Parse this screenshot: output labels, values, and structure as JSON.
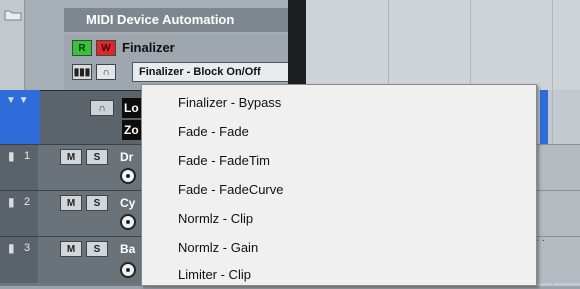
{
  "folder_track": {
    "title": "MIDI Device Automation"
  },
  "automation_track": {
    "read_label": "R",
    "write_label": "W",
    "name": "Finalizer",
    "parameter": "Finalizer - Block On/Off"
  },
  "marker_track": {
    "label_1": "Lo",
    "label_2": "Zo"
  },
  "tracks": [
    {
      "number": "1",
      "mute": "M",
      "solo": "S",
      "name": "Dr"
    },
    {
      "number": "2",
      "mute": "M",
      "solo": "S",
      "name": "Cy"
    },
    {
      "number": "3",
      "mute": "M",
      "solo": "S",
      "name": "Ba"
    }
  ],
  "popup_menu": {
    "items": [
      "Finalizer - Bypass",
      "Fade - Fade",
      "Fade - FadeTim",
      "Fade - FadeCurve",
      "Normlz - Clip",
      "Normlz - Gain",
      "Limiter - Clip"
    ]
  },
  "icons": {
    "folder": "folder-icon",
    "piano": "piano-icon",
    "lock": "lock-icon",
    "bars": "bars-icon",
    "automation": "automation-icon"
  },
  "colors": {
    "read": "#37c23a",
    "write": "#e0262a",
    "marker": "#2f6cd9"
  }
}
